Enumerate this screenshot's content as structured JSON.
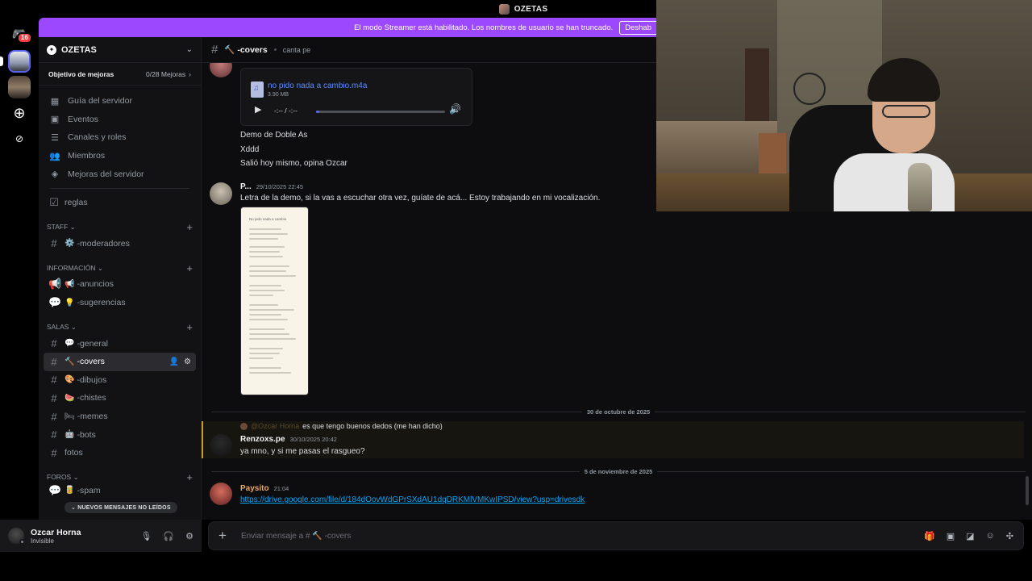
{
  "titlebar": {
    "title": "OZETAS"
  },
  "rail": {
    "badge": "16"
  },
  "banner": {
    "text": "El modo Streamer está habilitado. Los nombres de usuario se han truncado.",
    "button": "Deshab"
  },
  "guild": {
    "name": "OZETAS",
    "boost_label": "Objetivo de mejoras",
    "boost_value": "0/28 Mejoras"
  },
  "nav": [
    {
      "icon": "▦",
      "label": "Guía del servidor"
    },
    {
      "icon": "▣",
      "label": "Eventos"
    },
    {
      "icon": "☰",
      "label": "Canales y roles"
    },
    {
      "icon": "👥",
      "label": "Miembros"
    },
    {
      "icon": "◈",
      "label": "Mejoras del servidor"
    }
  ],
  "rules_channel": "reglas",
  "categories": {
    "staff": "STAFF",
    "info": "INFORMACIÓN",
    "salas": "SALAS",
    "foros": "FOROS"
  },
  "channels": {
    "moderadores": "-moderadores",
    "anuncios": "-anuncios",
    "sugerencias": "-sugerencias",
    "general": "-general",
    "covers": "-covers",
    "dibujos": "-dibujos",
    "chistes": "-chistes",
    "memes": "-memes",
    "bots": "-bots",
    "fotos": "fotos",
    "spam": "-spam"
  },
  "new_messages": "NUEVOS MENSAJES NO LEÍDOS",
  "user": {
    "name": "Ozcar Horna",
    "status": "Invisible"
  },
  "header": {
    "channel": "-covers",
    "topic": "canta pe"
  },
  "messages": {
    "audio": {
      "filename": "no pido nada a cambio.m4a",
      "size": "3.90 MB",
      "time": "-:-- / -:--"
    },
    "lines": [
      "Demo de Doble As",
      "Xddd",
      "Salió hoy mismo, opina Ozcar"
    ],
    "m2": {
      "author": "P...",
      "time": "29/10/2025 22:45",
      "text": "Letra de la demo, si la vas a escuchar otra vez, guíate de acá... Estoy trabajando en mi vocalización.",
      "doc_title": "No pido nada a cambio"
    },
    "sep1": "30 de octubre de 2025",
    "reply": {
      "name": "@Ozcar Horna",
      "text": "es que tengo buenos dedos (me han dicho)"
    },
    "m3": {
      "author": "Renzoxs.pe",
      "time": "30/10/2025 20:42",
      "text": "ya mno, y si me pasas el rasgueo?"
    },
    "sep2": "5 de noviembre de 2025",
    "m4": {
      "author": "Paysito",
      "time": "21:04",
      "link": "https://drive.google.com/file/d/184dOovWdGPrSXdAU1dqDRKMlVMKwIPSD/view?usp=drivesdk"
    }
  },
  "composer": {
    "placeholder": "Enviar mensaje a # 🔨 -covers"
  },
  "colors": {
    "accent": "#9b48ff",
    "link": "#00a8fc",
    "mention": "#c89d2a",
    "brand": "#5865f2"
  }
}
